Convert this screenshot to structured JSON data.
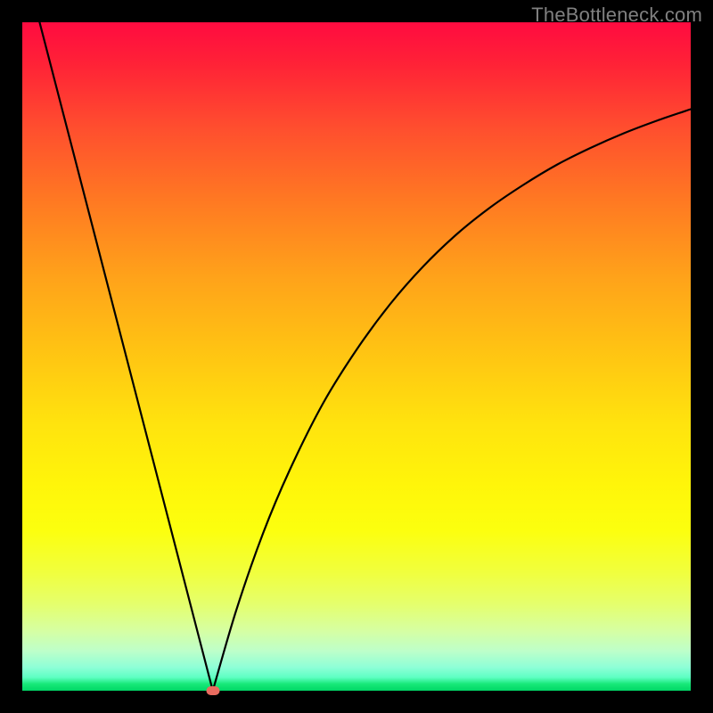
{
  "watermark": "TheBottleneck.com",
  "colors": {
    "frame": "#000000",
    "top": "#ff0b40",
    "bottom": "#00d766",
    "curve": "#000000",
    "marker": "#e96b5f",
    "watermark_text": "#808080"
  },
  "chart_data": {
    "type": "line",
    "title": "",
    "xlabel": "",
    "ylabel": "",
    "xlim": [
      0,
      1
    ],
    "ylim": [
      0,
      1
    ],
    "notes": "V-shaped bottleneck curve: left branch falls sharply from top-left to minimum at x≈0.285; right branch rises with decreasing slope toward upper-right. Minimum at marker (x≈0.285, y≈0). Background is a vertical gradient red→orange→yellow→green (bottleneck severity heatmap).",
    "series": [
      {
        "name": "left-branch",
        "x": [
          0.0,
          0.05,
          0.1,
          0.15,
          0.2,
          0.25,
          0.285
        ],
        "y": [
          1.1,
          0.907,
          0.714,
          0.521,
          0.328,
          0.135,
          0.0
        ]
      },
      {
        "name": "right-branch",
        "x": [
          0.285,
          0.32,
          0.36,
          0.4,
          0.45,
          0.5,
          0.55,
          0.6,
          0.65,
          0.7,
          0.75,
          0.8,
          0.85,
          0.9,
          0.95,
          1.0
        ],
        "y": [
          0.0,
          0.12,
          0.235,
          0.33,
          0.43,
          0.51,
          0.578,
          0.635,
          0.683,
          0.723,
          0.757,
          0.787,
          0.812,
          0.834,
          0.853,
          0.87
        ]
      }
    ],
    "marker": {
      "x": 0.285,
      "y": 0.0
    }
  }
}
